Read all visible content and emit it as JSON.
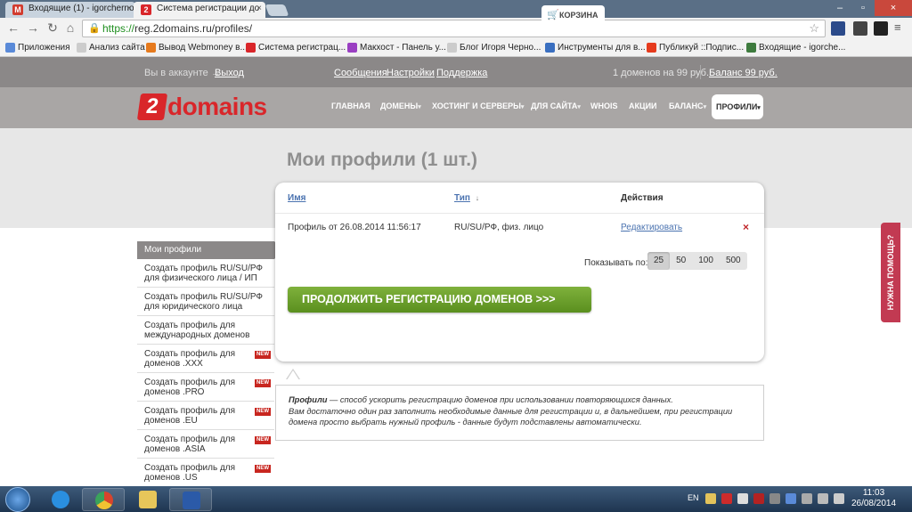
{
  "browser": {
    "tabs": [
      {
        "label": "Входящие (1) - igorcherno"
      },
      {
        "label": "Система регистрации до"
      }
    ],
    "url_scheme": "https://",
    "url_rest": "reg.2domains.ru/profiles/",
    "bookmarks": [
      {
        "label": "Приложения"
      },
      {
        "label": "Анализ сайта"
      },
      {
        "label": "Вывод Webmoney в..."
      },
      {
        "label": "Система регистрац..."
      },
      {
        "label": "Макхост - Панель у..."
      },
      {
        "label": "Блог Игоря Черно..."
      },
      {
        "label": "Инструменты для в..."
      },
      {
        "label": "Публикуй ::Подпис..."
      },
      {
        "label": "Входящие - igorche..."
      }
    ]
  },
  "topbar": {
    "account_text": "Вы в аккаунте →",
    "logout": "Выход",
    "messages": "Сообщения",
    "settings": "Настройки",
    "support": "Поддержка",
    "cart_label": "КОРЗИНА",
    "cart_info": "1 доменов на 99 руб.",
    "balance": "Баланс 99 руб."
  },
  "logo": {
    "digit": "2",
    "text": "domains"
  },
  "nav": {
    "items": [
      {
        "label": "ГЛАВНАЯ",
        "caret": ""
      },
      {
        "label": "ДОМЕНЫ",
        "caret": "▾"
      },
      {
        "label": "ХОСТИНГ И СЕРВЕРЫ",
        "caret": "▾"
      },
      {
        "label": "ДЛЯ САЙТА",
        "caret": "▾"
      },
      {
        "label": "WHOIS",
        "caret": ""
      },
      {
        "label": "АКЦИИ",
        "caret": ""
      },
      {
        "label": "БАЛАНС",
        "caret": "▾"
      }
    ],
    "active": "ПРОФИЛИ"
  },
  "page": {
    "title": "Мои профили (1 шт.)"
  },
  "sidebar": {
    "header": "Мои профили",
    "items": [
      {
        "l1": "Создать профиль RU/SU/РФ",
        "l2": "для физического лица / ИП",
        "badge": ""
      },
      {
        "l1": "Создать профиль RU/SU/РФ",
        "l2": "для юридического лица",
        "badge": ""
      },
      {
        "l1": "Создать профиль для",
        "l2": "международных доменов",
        "badge": ""
      },
      {
        "l1": "Создать профиль для",
        "l2": "доменов .XXX",
        "badge": "NEW"
      },
      {
        "l1": "Создать профиль для",
        "l2": "доменов .PRO",
        "badge": "NEW"
      },
      {
        "l1": "Создать профиль для",
        "l2": "доменов .EU",
        "badge": "NEW"
      },
      {
        "l1": "Создать профиль для",
        "l2": "доменов .ASIA",
        "badge": "NEW"
      },
      {
        "l1": "Создать профиль для",
        "l2": "доменов .US",
        "badge": "NEW"
      }
    ]
  },
  "table": {
    "col_name": "Имя",
    "col_type": "Тип",
    "sort_icon": "↓",
    "col_actions": "Действия",
    "row": {
      "name": "Профиль от 26.08.2014 11:56:17",
      "type": "RU/SU/РФ, физ. лицо",
      "action": "Редактировать",
      "delete": "×"
    }
  },
  "pager": {
    "label": "Показывать по:",
    "options": [
      "25",
      "50",
      "100",
      "500"
    ],
    "selected": "25"
  },
  "cta": "ПРОДОЛЖИТЬ РЕГИСТРАЦИЮ ДОМЕНОВ >>>",
  "info": {
    "bold": "Профили",
    "line1": " — способ ускорить регистрацию доменов при использовании повторяющихся данных.",
    "line2": "Вам достаточно один раз заполнить необходимые данные для регистрации и, в дальнейшем, при регистрации",
    "line3": "домена просто выбрать нужный профиль - данные будут подставлены автоматически."
  },
  "help": "НУЖНА ПОМОЩЬ?",
  "taskbar": {
    "lang": "EN",
    "time": "11:03",
    "date": "26/08/2014"
  },
  "colors": {
    "brand_red": "#d9262a",
    "cta_green": "#6ba12d",
    "link_blue": "#4b73b0",
    "help_pink": "#c23a52"
  }
}
